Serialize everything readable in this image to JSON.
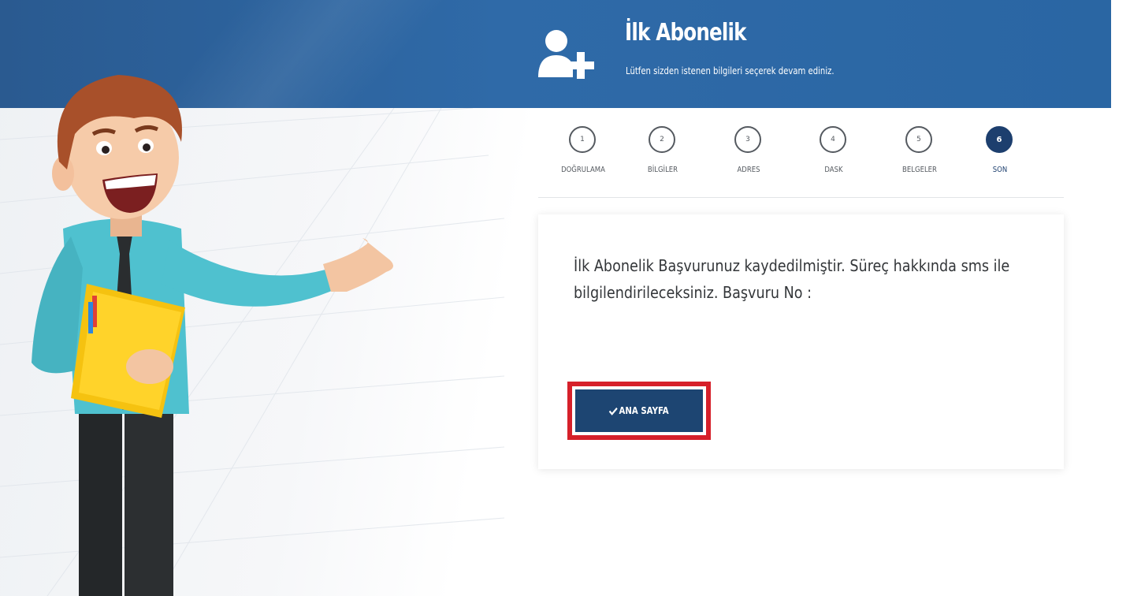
{
  "header": {
    "title": "İlk Abonelik",
    "subtitle": "Lütfen sizden istenen bilgileri seçerek devam ediniz.",
    "icon": "add-user-icon"
  },
  "steps": [
    {
      "number": "1",
      "label": "DOĞRULAMA",
      "active": false
    },
    {
      "number": "2",
      "label": "BİLGİLER",
      "active": false
    },
    {
      "number": "3",
      "label": "ADRES",
      "active": false
    },
    {
      "number": "4",
      "label": "DASK",
      "active": false
    },
    {
      "number": "5",
      "label": "BELGELER",
      "active": false
    },
    {
      "number": "6",
      "label": "SON",
      "active": true
    }
  ],
  "result": {
    "message": "İlk Abonelik Başvurunuz kaydedilmiştir. Süreç hakkında sms ile bilgilendirileceksiniz. Başvuru No :",
    "button_label": "ANA SAYFA",
    "button_icon": "check-icon"
  },
  "colors": {
    "header_blue": "#2a66a3",
    "active_step": "#1d3f6e",
    "button": "#1d4572",
    "highlight_border": "#d6202a"
  }
}
